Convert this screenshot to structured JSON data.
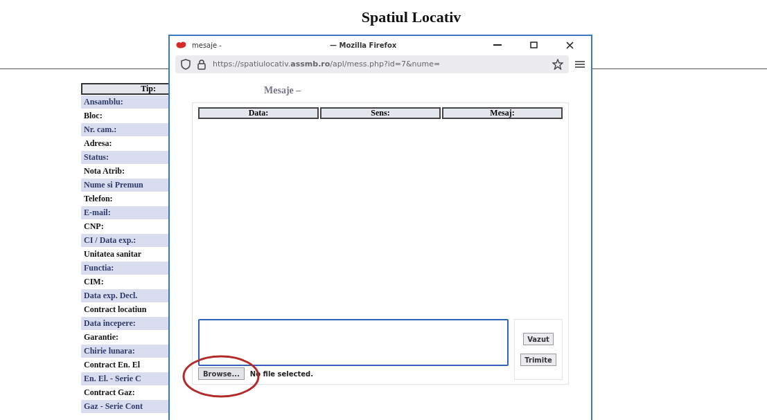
{
  "page": {
    "title": "Spatiul Locativ"
  },
  "info_table": {
    "header": "Tip:",
    "rows": [
      {
        "label": "Ansamblu:",
        "shaded": true
      },
      {
        "label": "Bloc:",
        "shaded": false
      },
      {
        "label": "Nr. cam.:",
        "shaded": true
      },
      {
        "label": "Adresa:",
        "shaded": false
      },
      {
        "label": "Status:",
        "shaded": true
      },
      {
        "label": "Nota Atrib:",
        "shaded": false
      },
      {
        "label": "Nume si Premun",
        "shaded": true
      },
      {
        "label": "Telefon:",
        "shaded": false
      },
      {
        "label": "E-mail:",
        "shaded": true
      },
      {
        "label": "CNP:",
        "shaded": false
      },
      {
        "label": "CI / Data exp.:",
        "shaded": true
      },
      {
        "label": "Unitatea sanitar",
        "shaded": false
      },
      {
        "label": "Functia:",
        "shaded": true
      },
      {
        "label": "CIM:",
        "shaded": false
      },
      {
        "label": "Data exp. Decl.",
        "shaded": true
      },
      {
        "label": "Contract locatiun",
        "shaded": false
      },
      {
        "label": "Data incepere:",
        "shaded": true
      },
      {
        "label": "Garantie:",
        "shaded": false
      },
      {
        "label": "Chirie lunara:",
        "shaded": true
      },
      {
        "label": "Contract En. El",
        "shaded": false
      },
      {
        "label": "En. El. - Serie C",
        "shaded": true
      },
      {
        "label": "Contract Gaz:",
        "shaded": false
      },
      {
        "label": "Gaz - Serie Cont",
        "shaded": true
      }
    ]
  },
  "popup": {
    "window_title": "mesaje -",
    "app_title": "— Mozilla Firefox",
    "url": "https://spatiulocativ.**assmb.ro**/apl/mess.php?id=7&nume=",
    "heading": "Mesaje –",
    "columns": [
      "Data:",
      "Sens:",
      "Mesaj:"
    ],
    "file_button": "Browse...",
    "file_status": "No file selected.",
    "buttons": [
      "Vazut",
      "Trimite"
    ]
  }
}
